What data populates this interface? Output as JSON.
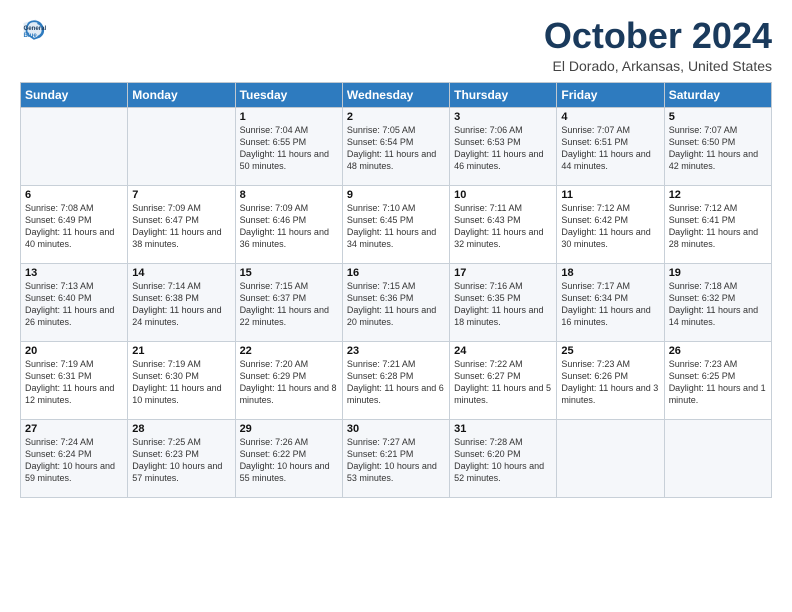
{
  "logo": {
    "line1": "General",
    "line2": "Blue"
  },
  "title": "October 2024",
  "subtitle": "El Dorado, Arkansas, United States",
  "headers": [
    "Sunday",
    "Monday",
    "Tuesday",
    "Wednesday",
    "Thursday",
    "Friday",
    "Saturday"
  ],
  "weeks": [
    [
      {
        "day": "",
        "sunrise": "",
        "sunset": "",
        "daylight": ""
      },
      {
        "day": "",
        "sunrise": "",
        "sunset": "",
        "daylight": ""
      },
      {
        "day": "1",
        "sunrise": "Sunrise: 7:04 AM",
        "sunset": "Sunset: 6:55 PM",
        "daylight": "Daylight: 11 hours and 50 minutes."
      },
      {
        "day": "2",
        "sunrise": "Sunrise: 7:05 AM",
        "sunset": "Sunset: 6:54 PM",
        "daylight": "Daylight: 11 hours and 48 minutes."
      },
      {
        "day": "3",
        "sunrise": "Sunrise: 7:06 AM",
        "sunset": "Sunset: 6:53 PM",
        "daylight": "Daylight: 11 hours and 46 minutes."
      },
      {
        "day": "4",
        "sunrise": "Sunrise: 7:07 AM",
        "sunset": "Sunset: 6:51 PM",
        "daylight": "Daylight: 11 hours and 44 minutes."
      },
      {
        "day": "5",
        "sunrise": "Sunrise: 7:07 AM",
        "sunset": "Sunset: 6:50 PM",
        "daylight": "Daylight: 11 hours and 42 minutes."
      }
    ],
    [
      {
        "day": "6",
        "sunrise": "Sunrise: 7:08 AM",
        "sunset": "Sunset: 6:49 PM",
        "daylight": "Daylight: 11 hours and 40 minutes."
      },
      {
        "day": "7",
        "sunrise": "Sunrise: 7:09 AM",
        "sunset": "Sunset: 6:47 PM",
        "daylight": "Daylight: 11 hours and 38 minutes."
      },
      {
        "day": "8",
        "sunrise": "Sunrise: 7:09 AM",
        "sunset": "Sunset: 6:46 PM",
        "daylight": "Daylight: 11 hours and 36 minutes."
      },
      {
        "day": "9",
        "sunrise": "Sunrise: 7:10 AM",
        "sunset": "Sunset: 6:45 PM",
        "daylight": "Daylight: 11 hours and 34 minutes."
      },
      {
        "day": "10",
        "sunrise": "Sunrise: 7:11 AM",
        "sunset": "Sunset: 6:43 PM",
        "daylight": "Daylight: 11 hours and 32 minutes."
      },
      {
        "day": "11",
        "sunrise": "Sunrise: 7:12 AM",
        "sunset": "Sunset: 6:42 PM",
        "daylight": "Daylight: 11 hours and 30 minutes."
      },
      {
        "day": "12",
        "sunrise": "Sunrise: 7:12 AM",
        "sunset": "Sunset: 6:41 PM",
        "daylight": "Daylight: 11 hours and 28 minutes."
      }
    ],
    [
      {
        "day": "13",
        "sunrise": "Sunrise: 7:13 AM",
        "sunset": "Sunset: 6:40 PM",
        "daylight": "Daylight: 11 hours and 26 minutes."
      },
      {
        "day": "14",
        "sunrise": "Sunrise: 7:14 AM",
        "sunset": "Sunset: 6:38 PM",
        "daylight": "Daylight: 11 hours and 24 minutes."
      },
      {
        "day": "15",
        "sunrise": "Sunrise: 7:15 AM",
        "sunset": "Sunset: 6:37 PM",
        "daylight": "Daylight: 11 hours and 22 minutes."
      },
      {
        "day": "16",
        "sunrise": "Sunrise: 7:15 AM",
        "sunset": "Sunset: 6:36 PM",
        "daylight": "Daylight: 11 hours and 20 minutes."
      },
      {
        "day": "17",
        "sunrise": "Sunrise: 7:16 AM",
        "sunset": "Sunset: 6:35 PM",
        "daylight": "Daylight: 11 hours and 18 minutes."
      },
      {
        "day": "18",
        "sunrise": "Sunrise: 7:17 AM",
        "sunset": "Sunset: 6:34 PM",
        "daylight": "Daylight: 11 hours and 16 minutes."
      },
      {
        "day": "19",
        "sunrise": "Sunrise: 7:18 AM",
        "sunset": "Sunset: 6:32 PM",
        "daylight": "Daylight: 11 hours and 14 minutes."
      }
    ],
    [
      {
        "day": "20",
        "sunrise": "Sunrise: 7:19 AM",
        "sunset": "Sunset: 6:31 PM",
        "daylight": "Daylight: 11 hours and 12 minutes."
      },
      {
        "day": "21",
        "sunrise": "Sunrise: 7:19 AM",
        "sunset": "Sunset: 6:30 PM",
        "daylight": "Daylight: 11 hours and 10 minutes."
      },
      {
        "day": "22",
        "sunrise": "Sunrise: 7:20 AM",
        "sunset": "Sunset: 6:29 PM",
        "daylight": "Daylight: 11 hours and 8 minutes."
      },
      {
        "day": "23",
        "sunrise": "Sunrise: 7:21 AM",
        "sunset": "Sunset: 6:28 PM",
        "daylight": "Daylight: 11 hours and 6 minutes."
      },
      {
        "day": "24",
        "sunrise": "Sunrise: 7:22 AM",
        "sunset": "Sunset: 6:27 PM",
        "daylight": "Daylight: 11 hours and 5 minutes."
      },
      {
        "day": "25",
        "sunrise": "Sunrise: 7:23 AM",
        "sunset": "Sunset: 6:26 PM",
        "daylight": "Daylight: 11 hours and 3 minutes."
      },
      {
        "day": "26",
        "sunrise": "Sunrise: 7:23 AM",
        "sunset": "Sunset: 6:25 PM",
        "daylight": "Daylight: 11 hours and 1 minute."
      }
    ],
    [
      {
        "day": "27",
        "sunrise": "Sunrise: 7:24 AM",
        "sunset": "Sunset: 6:24 PM",
        "daylight": "Daylight: 10 hours and 59 minutes."
      },
      {
        "day": "28",
        "sunrise": "Sunrise: 7:25 AM",
        "sunset": "Sunset: 6:23 PM",
        "daylight": "Daylight: 10 hours and 57 minutes."
      },
      {
        "day": "29",
        "sunrise": "Sunrise: 7:26 AM",
        "sunset": "Sunset: 6:22 PM",
        "daylight": "Daylight: 10 hours and 55 minutes."
      },
      {
        "day": "30",
        "sunrise": "Sunrise: 7:27 AM",
        "sunset": "Sunset: 6:21 PM",
        "daylight": "Daylight: 10 hours and 53 minutes."
      },
      {
        "day": "31",
        "sunrise": "Sunrise: 7:28 AM",
        "sunset": "Sunset: 6:20 PM",
        "daylight": "Daylight: 10 hours and 52 minutes."
      },
      {
        "day": "",
        "sunrise": "",
        "sunset": "",
        "daylight": ""
      },
      {
        "day": "",
        "sunrise": "",
        "sunset": "",
        "daylight": ""
      }
    ]
  ]
}
